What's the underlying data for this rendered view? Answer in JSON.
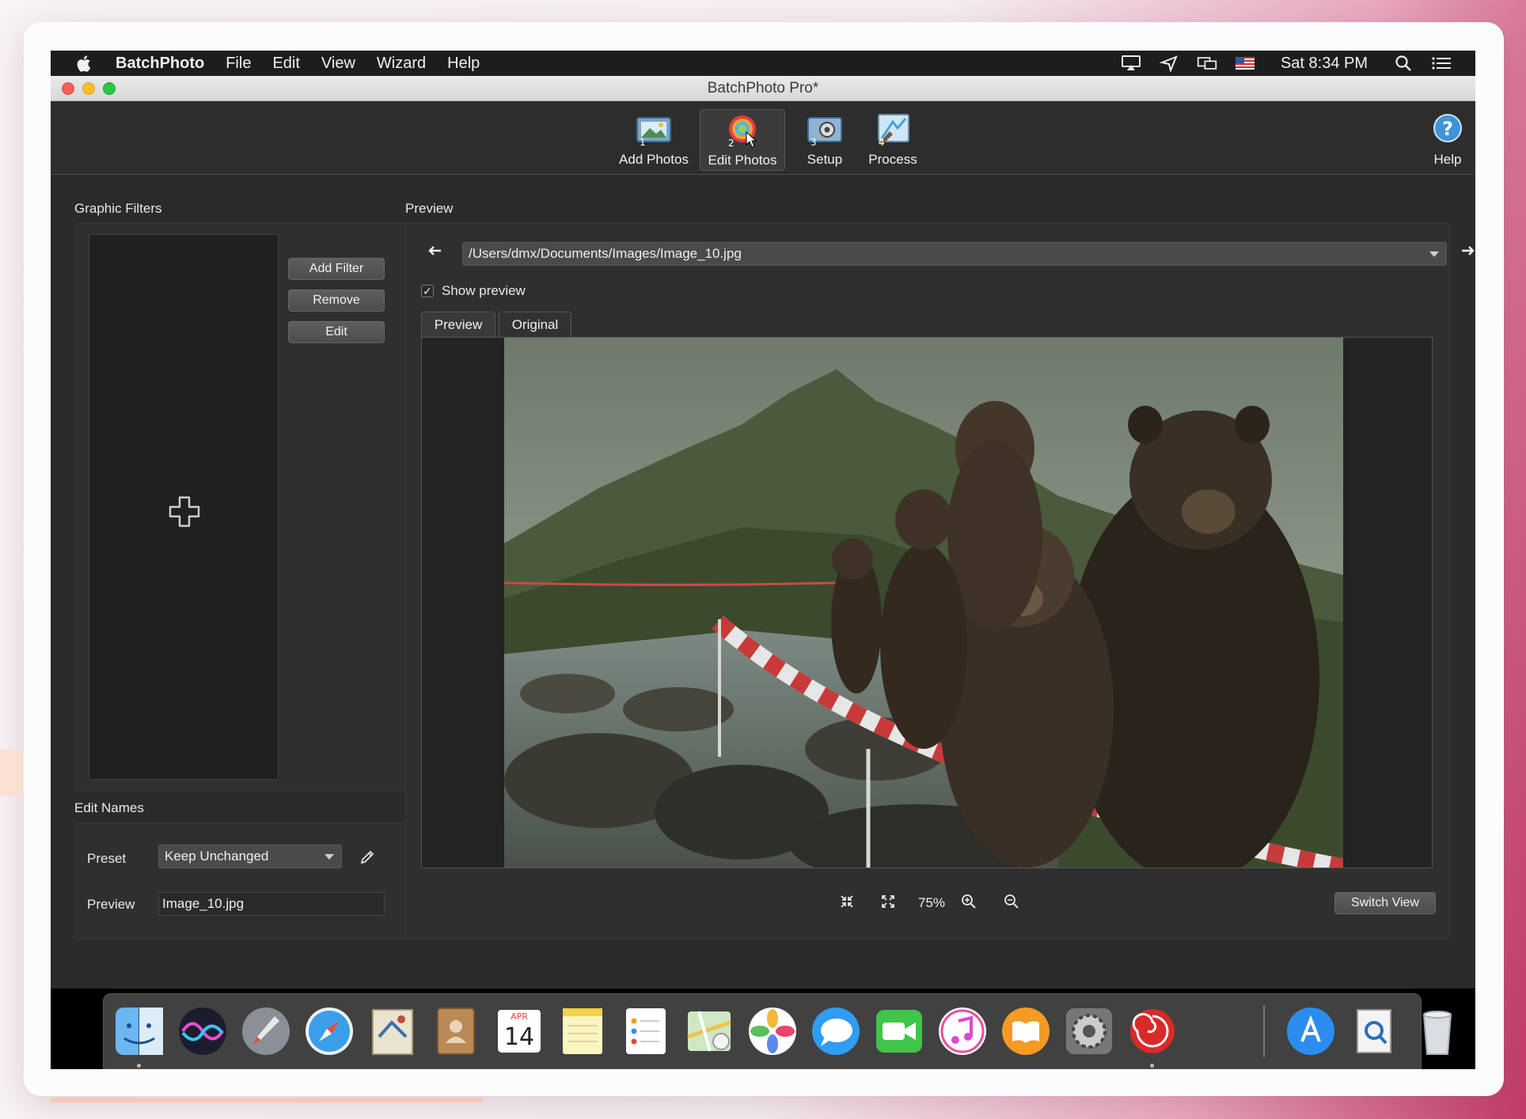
{
  "menubar": {
    "app_name": "BatchPhoto",
    "items": [
      "File",
      "Edit",
      "View",
      "Wizard",
      "Help"
    ],
    "clock": "Sat 8:34 PM"
  },
  "window": {
    "title": "BatchPhoto Pro*"
  },
  "toolbar": {
    "add_photos": "Add Photos",
    "edit_photos": "Edit Photos",
    "setup": "Setup",
    "process": "Process",
    "help": "Help"
  },
  "graphic_filters": {
    "heading": "Graphic Filters",
    "add_filter": "Add Filter",
    "remove": "Remove",
    "edit": "Edit"
  },
  "edit_names": {
    "heading": "Edit Names",
    "preset_label": "Preset",
    "preset_value": "Keep Unchanged",
    "preview_label": "Preview",
    "preview_value": "Image_10.jpg"
  },
  "preview": {
    "heading": "Preview",
    "path": "/Users/dmx/Documents/Images/Image_10.jpg",
    "show_preview": "Show preview",
    "show_preview_checked": true,
    "tab_preview": "Preview",
    "tab_original": "Original",
    "zoom": "75%",
    "switch_view": "Switch View"
  },
  "icons": {
    "apple": "apple-logo",
    "tray": [
      "airplay-icon",
      "location-icon",
      "display-icon",
      "us-flag-icon",
      "spotlight-icon",
      "notification-list-icon"
    ],
    "toolbar": [
      "add-photos-icon",
      "edit-photos-icon",
      "setup-icon",
      "process-icon",
      "help-icon"
    ],
    "dock": [
      "finder",
      "siri",
      "launchpad",
      "safari",
      "mail",
      "contacts",
      "calendar",
      "notes",
      "reminders",
      "maps",
      "photos",
      "messages",
      "facetime",
      "itunes",
      "ibooks",
      "system-preferences",
      "batchphoto",
      "app-store",
      "preview",
      "trash"
    ]
  },
  "dock": {
    "calendar_month": "APR",
    "calendar_day": "14"
  },
  "colors": {
    "window_bg": "#2b2b2b",
    "accent_red": "#c23b68"
  }
}
